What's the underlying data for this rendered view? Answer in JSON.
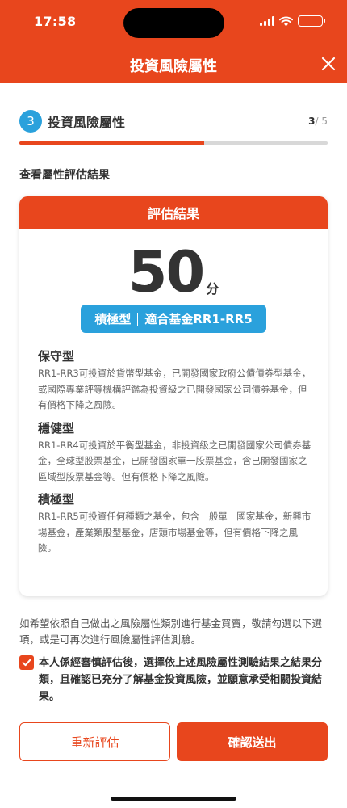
{
  "status_bar": {
    "time": "17:58"
  },
  "header": {
    "title": "投資風險屬性",
    "close_icon": "close-icon"
  },
  "step": {
    "number": "3",
    "title": "投資風險屬性",
    "current": "3",
    "total": "/ 5",
    "progress": 0.6
  },
  "section_title": "查看屬性評估結果",
  "result_card": {
    "header": "評估結果",
    "score": "50",
    "score_unit": "分",
    "badge_type": "積極型",
    "badge_funds": "適合基金RR1-RR5",
    "types": [
      {
        "name": "保守型",
        "desc": "RR1-RR3可投資於貨幣型基金，已開發國家政府公債債券型基金，或國際專業評等機構評鑑為投資級之已開發國家公司債券基金，但有價格下降之風險。"
      },
      {
        "name": "穩健型",
        "desc": "RR1-RR4可投資於平衡型基金，非投資級之已開發國家公司債券基金，全球型股票基金，已開發國家單一股票基金，含已開發國家之區域型股票基金等。但有價格下降之風險。"
      },
      {
        "name": "積極型",
        "desc": "RR1-RR5可投資任何種類之基金，包含一般單一國家基金，新興市場基金，產業類股型基金，店頭市場基金等，但有價格下降之風險。"
      }
    ]
  },
  "notice": "如希望依照自己做出之風險屬性類別進行基金買賣，敬請勾選以下選項，或是可再次進行風險屬性評估測驗。",
  "confirm": {
    "checked": true,
    "text": "本人係經審慎評估後，選擇依上述風險屬性測驗結果之結果分類，且確認已充分了解基金投資風險，並願意承受相關投資結果。"
  },
  "buttons": {
    "reassess": "重新評估",
    "submit": "確認送出"
  },
  "colors": {
    "brand": "#e8461d",
    "accent": "#2aa1dc"
  }
}
